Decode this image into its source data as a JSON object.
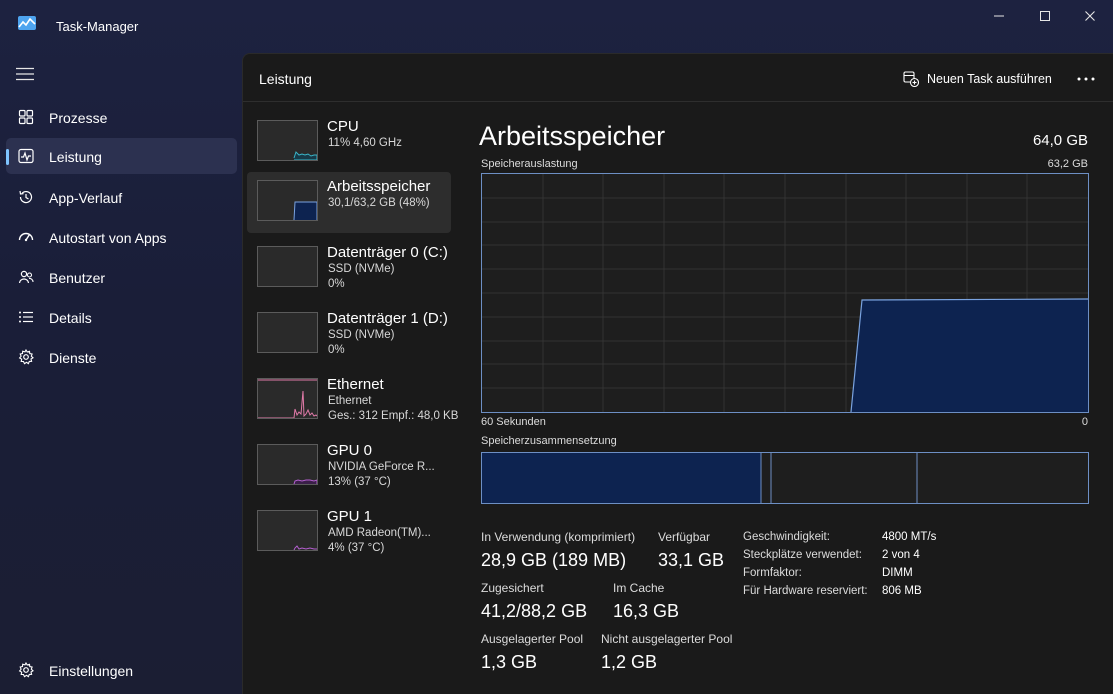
{
  "app": {
    "title": "Task-Manager"
  },
  "window_controls": {
    "minimize": "minimize-icon",
    "maximize": "maximize-icon",
    "close": "close-icon"
  },
  "sidebar": {
    "items": [
      {
        "label": "Prozesse",
        "icon": "processes-icon"
      },
      {
        "label": "Leistung",
        "icon": "performance-icon",
        "active": true
      },
      {
        "label": "App-Verlauf",
        "icon": "history-icon"
      },
      {
        "label": "Autostart von Apps",
        "icon": "startup-icon"
      },
      {
        "label": "Benutzer",
        "icon": "users-icon"
      },
      {
        "label": "Details",
        "icon": "details-icon"
      },
      {
        "label": "Dienste",
        "icon": "services-icon"
      }
    ],
    "settings_label": "Einstellungen"
  },
  "header": {
    "title": "Leistung",
    "new_task_label": "Neuen Task ausführen"
  },
  "resources": [
    {
      "name": "CPU",
      "sub1": "11% 4,60 GHz",
      "sub2": "",
      "color": "#3ab5c8",
      "usage": 0.11
    },
    {
      "name": "Arbeitsspeicher",
      "sub1": "30,1/63,2 GB (48%)",
      "sub2": "",
      "color": "#7aa3e0",
      "usage": 0.48,
      "selected": true
    },
    {
      "name": "Datenträger 0 (C:)",
      "sub1": "SSD (NVMe)",
      "sub2": "0%",
      "color": "#5fa85f",
      "usage": 0
    },
    {
      "name": "Datenträger 1 (D:)",
      "sub1": "SSD (NVMe)",
      "sub2": "0%",
      "color": "#5fa85f",
      "usage": 0
    },
    {
      "name": "Ethernet",
      "sub1": "Ethernet",
      "sub2": "Ges.: 312  Empf.: 48,0 KB",
      "color": "#e07aa8"
    },
    {
      "name": "GPU 0",
      "sub1": "NVIDIA GeForce R...",
      "sub2": "13%  (37 °C)",
      "color": "#b45fd0",
      "usage": 0.13
    },
    {
      "name": "GPU 1",
      "sub1": "AMD Radeon(TM)...",
      "sub2": "4%  (37 °C)",
      "color": "#b45fd0",
      "usage": 0.04
    }
  ],
  "detail": {
    "title": "Arbeitsspeicher",
    "total": "64,0 GB",
    "graph_label": "Speicherauslastung",
    "graph_max": "63,2 GB",
    "graph_time": "60 Sekunden",
    "graph_zero": "0",
    "composition_label": "Speicherzusammensetzung",
    "in_use_fraction": 0.48,
    "stats": {
      "in_use_label": "In Verwendung (komprimiert)",
      "in_use_value": "28,9 GB (189 MB)",
      "available_label": "Verfügbar",
      "available_value": "33,1 GB",
      "committed_label": "Zugesichert",
      "committed_value": "41,2/88,2 GB",
      "cached_label": "Im Cache",
      "cached_value": "16,3 GB",
      "paged_label": "Ausgelagerter Pool",
      "paged_value": "1,3 GB",
      "nonpaged_label": "Nicht ausgelagerter Pool",
      "nonpaged_value": "1,2 GB"
    },
    "kv": [
      {
        "label": "Geschwindigkeit:",
        "value": "4800 MT/s"
      },
      {
        "label": "Steckplätze verwendet:",
        "value": "2 von 4"
      },
      {
        "label": "Formfaktor:",
        "value": "DIMM"
      },
      {
        "label": "Für Hardware reserviert:",
        "value": "806 MB"
      }
    ]
  },
  "colors": {
    "accent": "#7fc4ff",
    "memory_line": "#7aa3e0",
    "memory_fill": "#0d2350"
  }
}
